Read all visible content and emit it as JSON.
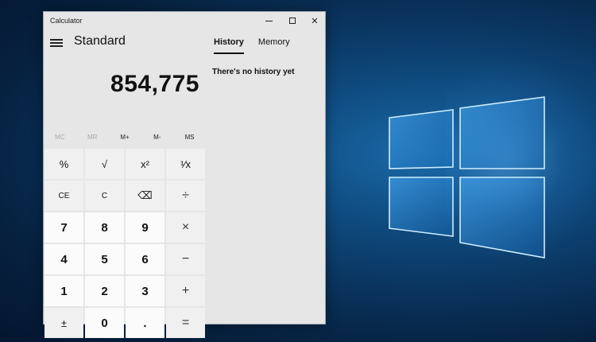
{
  "window": {
    "title": "Calculator",
    "controls": {
      "minimize_icon": "minimize-icon",
      "maximize_icon": "maximize-icon",
      "close_icon": "close-icon",
      "close_glyph": "✕"
    }
  },
  "header": {
    "menu_icon": "hamburger-menu-icon",
    "mode": "Standard"
  },
  "display": {
    "value": "854,775"
  },
  "memory": {
    "buttons": [
      {
        "label": "MC",
        "enabled": false
      },
      {
        "label": "MR",
        "enabled": false
      },
      {
        "label": "M+",
        "enabled": true
      },
      {
        "label": "M-",
        "enabled": true
      },
      {
        "label": "MS",
        "enabled": true
      }
    ]
  },
  "keys": [
    {
      "label": "%",
      "name": "percent"
    },
    {
      "label": "√",
      "name": "square-root"
    },
    {
      "label": "x²",
      "name": "square"
    },
    {
      "label": "¹⁄x",
      "name": "reciprocal"
    },
    {
      "label": "CE",
      "name": "clear-entry"
    },
    {
      "label": "C",
      "name": "clear"
    },
    {
      "label": "⌫",
      "name": "backspace"
    },
    {
      "label": "÷",
      "name": "divide"
    },
    {
      "label": "7",
      "name": "digit-7"
    },
    {
      "label": "8",
      "name": "digit-8"
    },
    {
      "label": "9",
      "name": "digit-9"
    },
    {
      "label": "×",
      "name": "multiply"
    },
    {
      "label": "4",
      "name": "digit-4"
    },
    {
      "label": "5",
      "name": "digit-5"
    },
    {
      "label": "6",
      "name": "digit-6"
    },
    {
      "label": "−",
      "name": "subtract"
    },
    {
      "label": "1",
      "name": "digit-1"
    },
    {
      "label": "2",
      "name": "digit-2"
    },
    {
      "label": "3",
      "name": "digit-3"
    },
    {
      "label": "+",
      "name": "add"
    },
    {
      "label": "±",
      "name": "negate"
    },
    {
      "label": "0",
      "name": "digit-0"
    },
    {
      "label": ".",
      "name": "decimal"
    },
    {
      "label": "=",
      "name": "equals"
    }
  ],
  "side_panel": {
    "tabs": [
      {
        "label": "History",
        "active": true
      },
      {
        "label": "Memory",
        "active": false
      }
    ],
    "empty_message": "There's no history yet"
  },
  "colors": {
    "window_bg": "#e6e6e6",
    "number_key_bg": "#fbfbfb",
    "operator_key_bg": "#f0f0f0",
    "desktop_bg": "#0a3560",
    "logo_glow": "#3aa6ff"
  }
}
